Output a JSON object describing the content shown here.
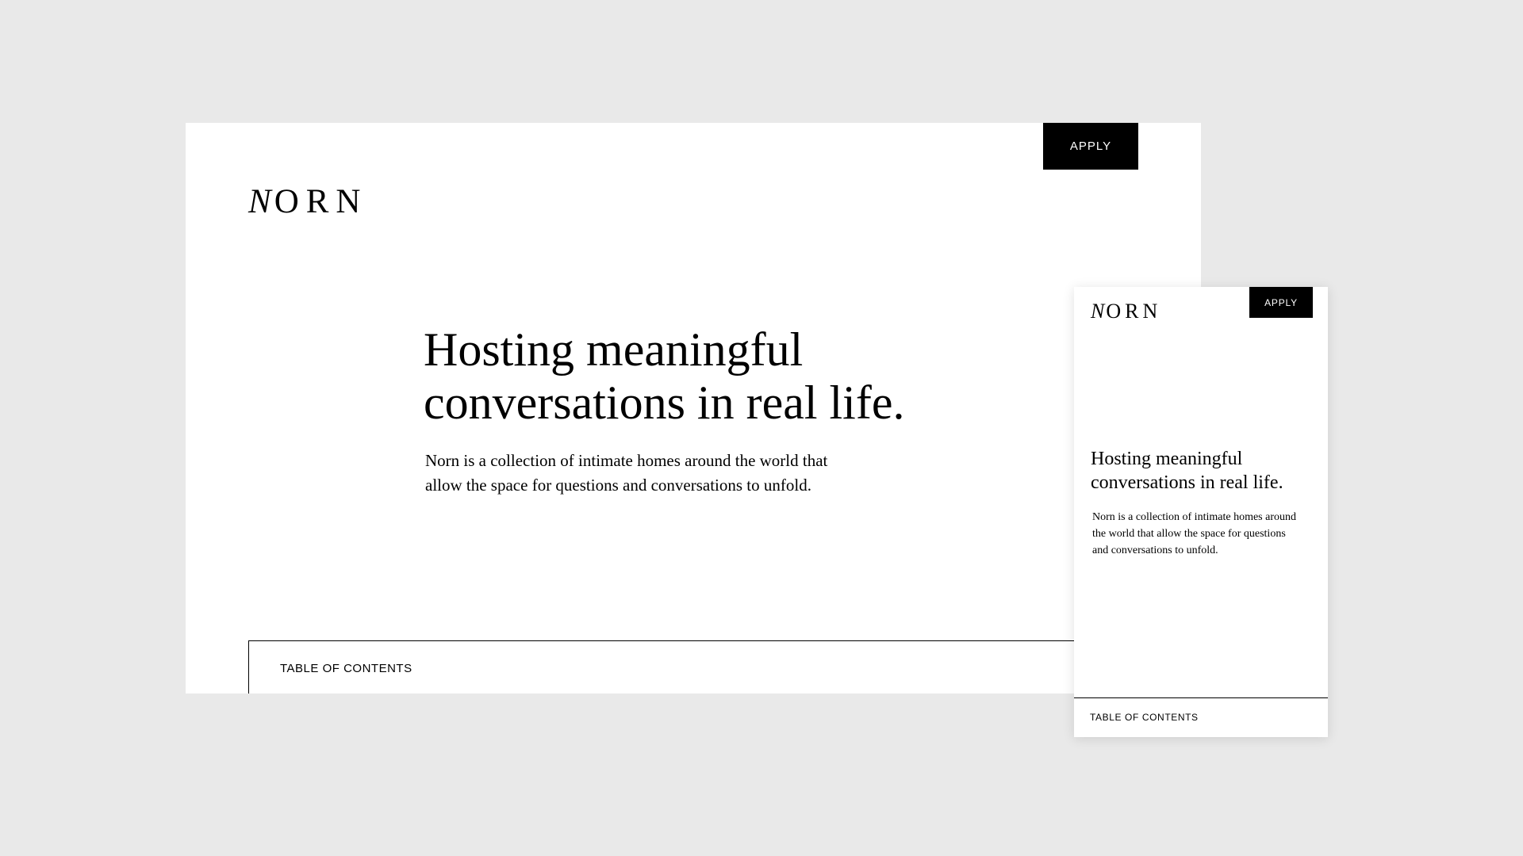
{
  "brand": {
    "logo_initial": "N",
    "logo_rest": "ORN"
  },
  "desktop": {
    "apply_label": "APPLY",
    "headline_line1": "Hosting meaningful",
    "headline_line2": "conversations in real life.",
    "lede_line1": "Norn is a collection of intimate homes around the world that",
    "lede_line2": "allow the space for questions and conversations to unfold.",
    "toc_label": "TABLE OF CONTENTS"
  },
  "mobile": {
    "apply_label": "APPLY",
    "headline_line1": "Hosting meaningful",
    "headline_line2": "conversations in real life.",
    "lede_line1": "Norn is a collection of intimate homes around",
    "lede_line2": "the world that allow the space for questions",
    "lede_line3": "and conversations to unfold.",
    "toc_label": "TABLE OF CONTENTS"
  },
  "colors": {
    "background": "#e9e9e9",
    "surface": "#ffffff",
    "accent": "#000000"
  }
}
